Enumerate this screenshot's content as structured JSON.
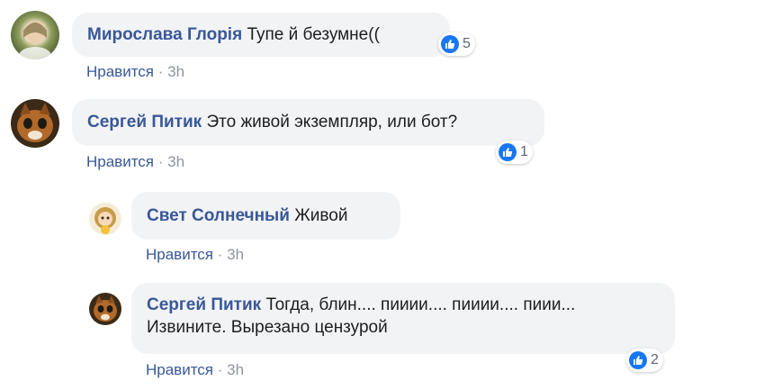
{
  "colors": {
    "link": "#385898",
    "bubble": "#f2f3f5",
    "like": "#1877f2",
    "muted": "#90949c"
  },
  "comments": [
    {
      "author": "Мирослава Глорія",
      "text": "Тупе й безумне((",
      "text_line2": "",
      "likes": "5",
      "like_label": "Нравится",
      "dot": "·",
      "time": "3h"
    },
    {
      "author": "Сергей Питик",
      "text": "Это живой экземпляр, или бот?",
      "text_line2": "",
      "likes": "1",
      "like_label": "Нравится",
      "dot": "·",
      "time": "3h"
    },
    {
      "author": "Свет Солнечный",
      "text": "Живой",
      "text_line2": "",
      "likes": "",
      "like_label": "Нравится",
      "dot": "·",
      "time": "3h"
    },
    {
      "author": "Сергей Питик",
      "text": "Тогда, блин.... пииии.... пииии.... пиии...",
      "text_line2": "Извините. Вырезано цензурой",
      "likes": "2",
      "like_label": "Нравится",
      "dot": "·",
      "time": "3h"
    }
  ]
}
